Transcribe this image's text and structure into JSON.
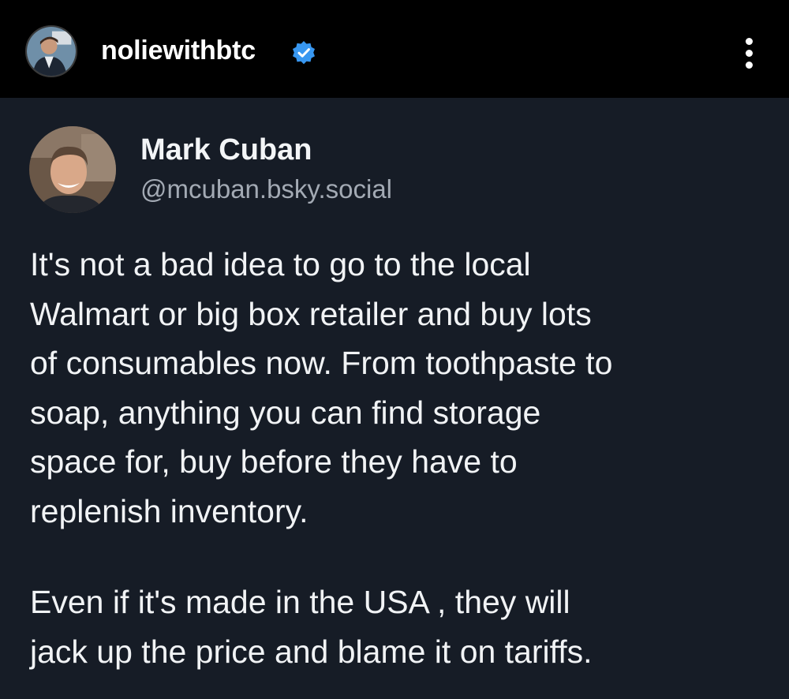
{
  "header": {
    "username": "noliewithbtc",
    "avatar_icon": "profile-avatar-icon",
    "verified_icon": "verified-badge-icon",
    "more_icon": "more-options-icon",
    "background": "#000000"
  },
  "post": {
    "display_name": "Mark Cuban",
    "handle": "@mcuban.bsky.social",
    "paragraphs": [
      "It's not a bad idea to go to the local\nWalmart or big box retailer and buy lots\nof consumables now.  From toothpaste to\nsoap, anything you can find storage\nspace for, buy before they have to\nreplenish inventory.",
      "Even if it's made in the USA , they will\njack up the price and blame it on tariffs."
    ],
    "background": "#161c26",
    "text_color": "#f1f3f5",
    "handle_color": "#a3aab4"
  },
  "colors": {
    "verified_blue": "#3897f0"
  }
}
